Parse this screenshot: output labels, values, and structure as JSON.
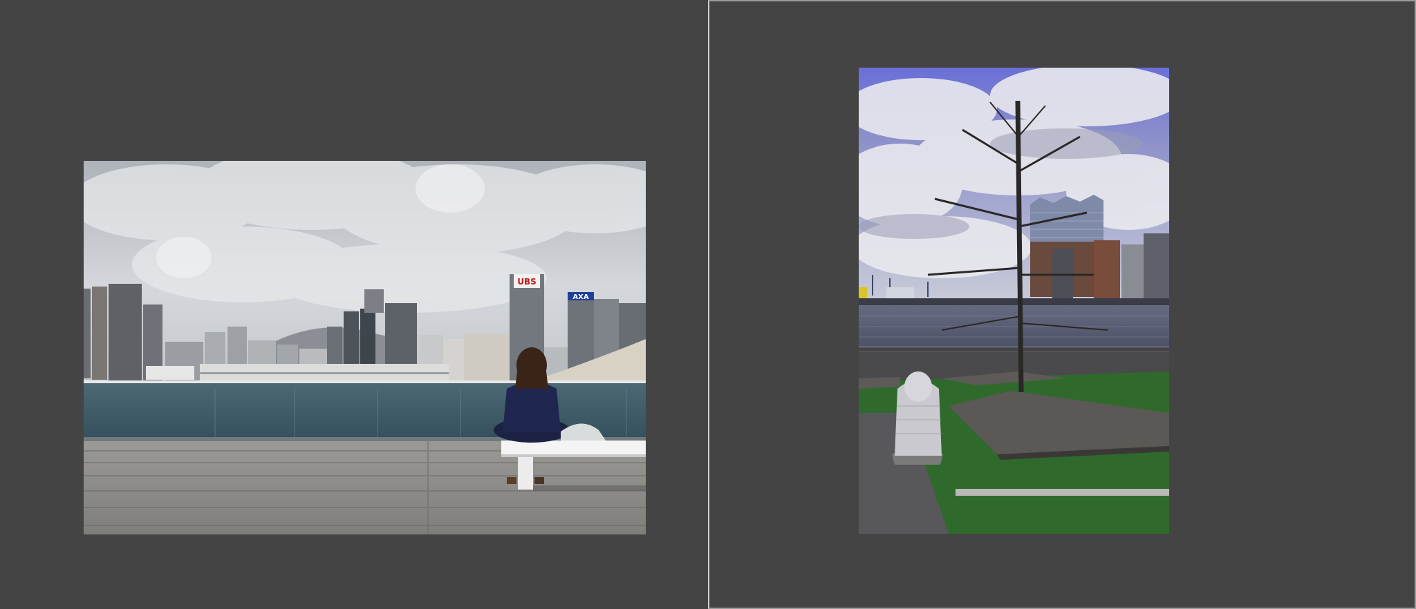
{
  "viewer": {
    "background": "#444444",
    "panels": [
      {
        "photo": {
          "sign_ubs": "UBS",
          "sign_axa": "AXA"
        }
      },
      {
        "photo": {}
      }
    ]
  },
  "colors": {
    "sky_left": "#c9cdd3",
    "water_left": "#3e5a66",
    "deck_left": "#8f8f8c",
    "sky_right": "#6b6fd6",
    "grass_right": "#2d6a2a",
    "water_right": "#5a5f72"
  }
}
